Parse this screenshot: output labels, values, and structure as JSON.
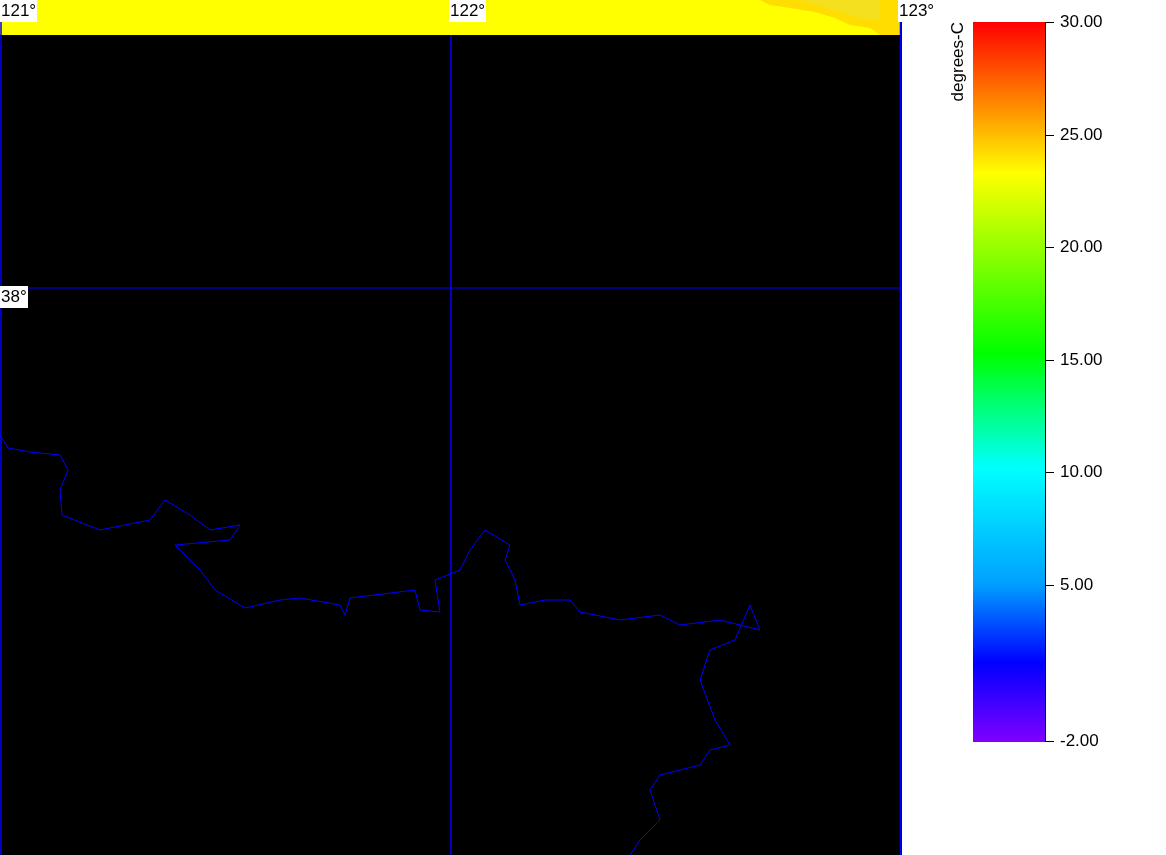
{
  "map": {
    "grid_labels": [
      {
        "text": "121°"
      },
      {
        "text": "122°"
      },
      {
        "text": "123°"
      },
      {
        "text": "38°"
      }
    ]
  },
  "colorbar": {
    "title": "degrees-C",
    "ticks": [
      "30.00",
      "25.00",
      "20.00",
      "15.00",
      "10.00",
      "5.00",
      "-2.00"
    ]
  }
}
